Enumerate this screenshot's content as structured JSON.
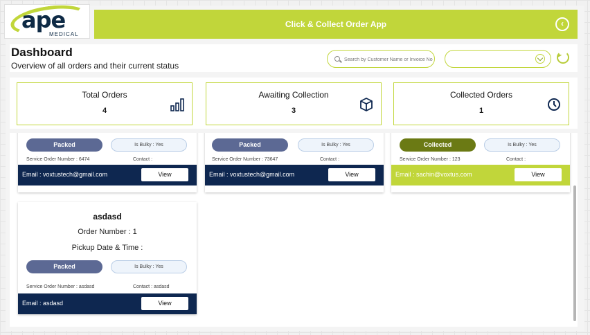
{
  "app": {
    "title": "Click & Collect Order App"
  },
  "logo": {
    "text": "ape",
    "sub": "MEDICAL"
  },
  "page": {
    "title": "Dashboard",
    "subtitle": "Overview of all orders and their current status"
  },
  "search": {
    "placeholder": "Search by Customer Name or Invoice No",
    "value": ""
  },
  "status_filter": {
    "value": ""
  },
  "stats": [
    {
      "label": "Total Orders",
      "value": "4",
      "icon": "bar-chart-icon"
    },
    {
      "label": "Awaiting Collection",
      "value": "3",
      "icon": "box-icon"
    },
    {
      "label": "Collected Orders",
      "value": "1",
      "icon": "clock-icon"
    }
  ],
  "orders": [
    {
      "status": "Packed",
      "bulky": "Is Bulky : Yes",
      "service_order": "Service Order Number : 6474",
      "contact": "Contact :",
      "email": "Email : voxtustech@gmail.com",
      "view": "View"
    },
    {
      "status": "Packed",
      "bulky": "Is Bulky : Yes",
      "service_order": "Service Order Number : 73647",
      "contact": "Contact :",
      "email": "Email : voxtustech@gmail.com",
      "view": "View"
    },
    {
      "status": "Collected",
      "bulky": "Is Bulky : Yes",
      "service_order": "Service Order Number : 123",
      "contact": "Contact :",
      "email": "Email : sachin@voxtus.com",
      "view": "View"
    },
    {
      "name": "asdasd",
      "order_number": "Order Number :  1",
      "pickup": "Pickup Date & Time :",
      "status": "Packed",
      "bulky": "Is Bulky : Yes",
      "service_order": "Service Order Number : asdasd",
      "contact": "Contact : asdasd",
      "email": "Email : asdasd",
      "view": "View"
    }
  ],
  "colors": {
    "accent": "#c1d63a",
    "navy": "#0e2750",
    "packed": "#5c6994",
    "collected": "#6b7a14"
  }
}
